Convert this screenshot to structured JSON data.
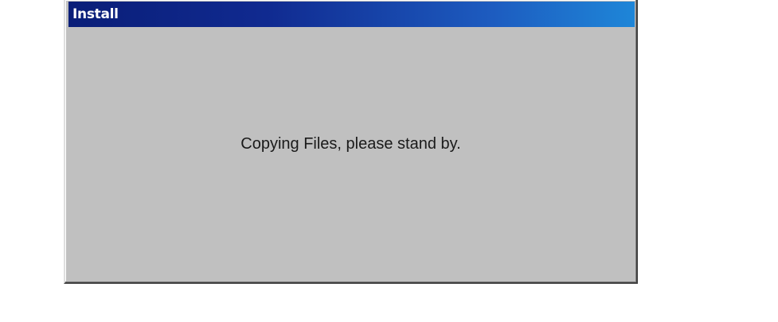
{
  "window": {
    "title": "Install"
  },
  "content": {
    "message": "Copying Files, please stand by."
  },
  "colors": {
    "titlebar_start": "#0a1e78",
    "titlebar_end": "#1e86d8",
    "dialog_background": "#c0c0c0"
  }
}
